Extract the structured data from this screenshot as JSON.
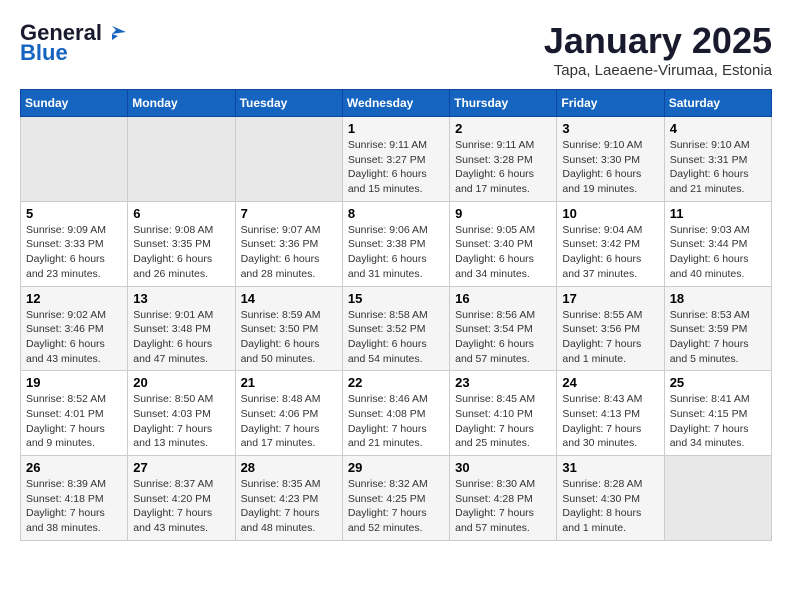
{
  "header": {
    "logo_line1": "General",
    "logo_line2": "Blue",
    "month": "January 2025",
    "location": "Tapa, Laeaene-Virumaa, Estonia"
  },
  "weekdays": [
    "Sunday",
    "Monday",
    "Tuesday",
    "Wednesday",
    "Thursday",
    "Friday",
    "Saturday"
  ],
  "weeks": [
    [
      {
        "day": "",
        "info": ""
      },
      {
        "day": "",
        "info": ""
      },
      {
        "day": "",
        "info": ""
      },
      {
        "day": "1",
        "info": "Sunrise: 9:11 AM\nSunset: 3:27 PM\nDaylight: 6 hours\nand 15 minutes."
      },
      {
        "day": "2",
        "info": "Sunrise: 9:11 AM\nSunset: 3:28 PM\nDaylight: 6 hours\nand 17 minutes."
      },
      {
        "day": "3",
        "info": "Sunrise: 9:10 AM\nSunset: 3:30 PM\nDaylight: 6 hours\nand 19 minutes."
      },
      {
        "day": "4",
        "info": "Sunrise: 9:10 AM\nSunset: 3:31 PM\nDaylight: 6 hours\nand 21 minutes."
      }
    ],
    [
      {
        "day": "5",
        "info": "Sunrise: 9:09 AM\nSunset: 3:33 PM\nDaylight: 6 hours\nand 23 minutes."
      },
      {
        "day": "6",
        "info": "Sunrise: 9:08 AM\nSunset: 3:35 PM\nDaylight: 6 hours\nand 26 minutes."
      },
      {
        "day": "7",
        "info": "Sunrise: 9:07 AM\nSunset: 3:36 PM\nDaylight: 6 hours\nand 28 minutes."
      },
      {
        "day": "8",
        "info": "Sunrise: 9:06 AM\nSunset: 3:38 PM\nDaylight: 6 hours\nand 31 minutes."
      },
      {
        "day": "9",
        "info": "Sunrise: 9:05 AM\nSunset: 3:40 PM\nDaylight: 6 hours\nand 34 minutes."
      },
      {
        "day": "10",
        "info": "Sunrise: 9:04 AM\nSunset: 3:42 PM\nDaylight: 6 hours\nand 37 minutes."
      },
      {
        "day": "11",
        "info": "Sunrise: 9:03 AM\nSunset: 3:44 PM\nDaylight: 6 hours\nand 40 minutes."
      }
    ],
    [
      {
        "day": "12",
        "info": "Sunrise: 9:02 AM\nSunset: 3:46 PM\nDaylight: 6 hours\nand 43 minutes."
      },
      {
        "day": "13",
        "info": "Sunrise: 9:01 AM\nSunset: 3:48 PM\nDaylight: 6 hours\nand 47 minutes."
      },
      {
        "day": "14",
        "info": "Sunrise: 8:59 AM\nSunset: 3:50 PM\nDaylight: 6 hours\nand 50 minutes."
      },
      {
        "day": "15",
        "info": "Sunrise: 8:58 AM\nSunset: 3:52 PM\nDaylight: 6 hours\nand 54 minutes."
      },
      {
        "day": "16",
        "info": "Sunrise: 8:56 AM\nSunset: 3:54 PM\nDaylight: 6 hours\nand 57 minutes."
      },
      {
        "day": "17",
        "info": "Sunrise: 8:55 AM\nSunset: 3:56 PM\nDaylight: 7 hours\nand 1 minute."
      },
      {
        "day": "18",
        "info": "Sunrise: 8:53 AM\nSunset: 3:59 PM\nDaylight: 7 hours\nand 5 minutes."
      }
    ],
    [
      {
        "day": "19",
        "info": "Sunrise: 8:52 AM\nSunset: 4:01 PM\nDaylight: 7 hours\nand 9 minutes."
      },
      {
        "day": "20",
        "info": "Sunrise: 8:50 AM\nSunset: 4:03 PM\nDaylight: 7 hours\nand 13 minutes."
      },
      {
        "day": "21",
        "info": "Sunrise: 8:48 AM\nSunset: 4:06 PM\nDaylight: 7 hours\nand 17 minutes."
      },
      {
        "day": "22",
        "info": "Sunrise: 8:46 AM\nSunset: 4:08 PM\nDaylight: 7 hours\nand 21 minutes."
      },
      {
        "day": "23",
        "info": "Sunrise: 8:45 AM\nSunset: 4:10 PM\nDaylight: 7 hours\nand 25 minutes."
      },
      {
        "day": "24",
        "info": "Sunrise: 8:43 AM\nSunset: 4:13 PM\nDaylight: 7 hours\nand 30 minutes."
      },
      {
        "day": "25",
        "info": "Sunrise: 8:41 AM\nSunset: 4:15 PM\nDaylight: 7 hours\nand 34 minutes."
      }
    ],
    [
      {
        "day": "26",
        "info": "Sunrise: 8:39 AM\nSunset: 4:18 PM\nDaylight: 7 hours\nand 38 minutes."
      },
      {
        "day": "27",
        "info": "Sunrise: 8:37 AM\nSunset: 4:20 PM\nDaylight: 7 hours\nand 43 minutes."
      },
      {
        "day": "28",
        "info": "Sunrise: 8:35 AM\nSunset: 4:23 PM\nDaylight: 7 hours\nand 48 minutes."
      },
      {
        "day": "29",
        "info": "Sunrise: 8:32 AM\nSunset: 4:25 PM\nDaylight: 7 hours\nand 52 minutes."
      },
      {
        "day": "30",
        "info": "Sunrise: 8:30 AM\nSunset: 4:28 PM\nDaylight: 7 hours\nand 57 minutes."
      },
      {
        "day": "31",
        "info": "Sunrise: 8:28 AM\nSunset: 4:30 PM\nDaylight: 8 hours\nand 1 minute."
      },
      {
        "day": "",
        "info": ""
      }
    ]
  ]
}
